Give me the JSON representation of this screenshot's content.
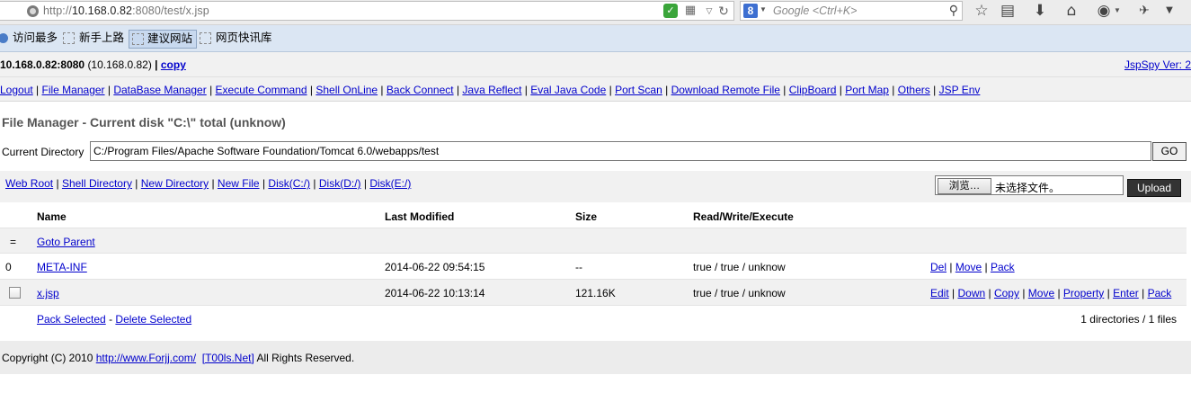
{
  "browser": {
    "url_prefix": "http://",
    "url_host": "10.168.0.82",
    "url_rest": ":8080/test/x.jsp",
    "search_placeholder": "Google <Ctrl+K>",
    "search_engine_letter": "8"
  },
  "bookmarks": {
    "most_visited": "访问最多",
    "newbie": "新手上路",
    "suggested": "建议网站",
    "library": "网页快讯库"
  },
  "header": {
    "host_bold": "10.168.0.82:8080",
    "host_ip": "(10.168.0.82)",
    "separator": "|",
    "copy_label": "copy",
    "version_label": "JspSpy Ver: 2"
  },
  "nav": {
    "items": [
      "Logout",
      "File Manager",
      "DataBase Manager",
      "Execute Command",
      "Shell OnLine",
      "Back Connect",
      "Java Reflect",
      "Eval Java Code",
      "Port Scan",
      "Download Remote File",
      "ClipBoard",
      "Port Map",
      "Others",
      "JSP Env"
    ]
  },
  "file_manager": {
    "title": "File Manager - Current disk \"C:\\\" total (unknow)",
    "current_dir_label": "Current Directory",
    "current_dir_value": "C:/Program Files/Apache Software Foundation/Tomcat 6.0/webapps/test",
    "go_label": "GO",
    "tool_links": [
      "Web Root",
      "Shell Directory",
      "New Directory",
      "New File",
      "Disk(C:/)",
      "Disk(D:/)",
      "Disk(E:/)"
    ],
    "browse_label": "浏览…",
    "file_status": "未选择文件。",
    "upload_label": "Upload"
  },
  "table": {
    "headers": {
      "name": "Name",
      "last_modified": "Last Modified",
      "size": "Size",
      "rwe": "Read/Write/Execute"
    },
    "parent_marker": "=",
    "parent_label": "Goto Parent",
    "rows": [
      {
        "marker": "0",
        "name": "META-INF",
        "modified": "2014-06-22 09:54:15",
        "size": "--",
        "rwe": "true / true / unknow",
        "actions": [
          "Del",
          "Move",
          "Pack"
        ]
      },
      {
        "marker": "",
        "name": "x.jsp",
        "modified": "2014-06-22 10:13:14",
        "size": "121.16K",
        "rwe": "true / true / unknow",
        "actions": [
          "Edit",
          "Down",
          "Copy",
          "Move",
          "Property",
          "Enter",
          "Pack"
        ]
      }
    ],
    "pack_selected": "Pack Selected",
    "dash": "-",
    "delete_selected": "Delete Selected",
    "summary": "1 directories / 1 files"
  },
  "footer": {
    "prefix": "Copyright (C) 2010",
    "site_link": "http://www.Forjj.com/",
    "team_link": "[T00ls.Net]",
    "suffix": "All Rights Reserved."
  }
}
